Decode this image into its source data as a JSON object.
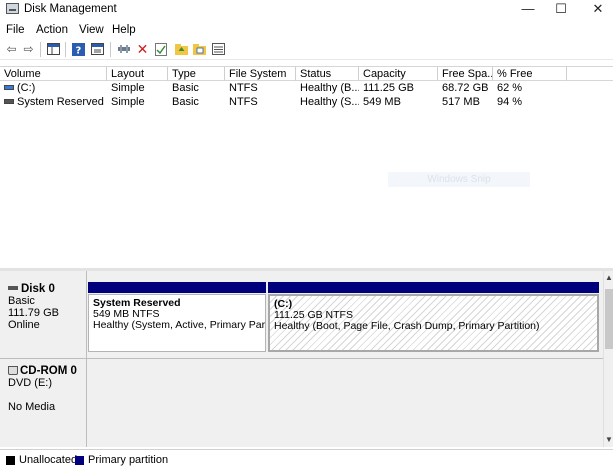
{
  "window": {
    "title": "Disk Management",
    "controls": {
      "minimize": "—",
      "maximize": "☐",
      "close": "✕"
    }
  },
  "menu": [
    "File",
    "Action",
    "View",
    "Help"
  ],
  "toolbar": {
    "buttons": [
      "back-icon",
      "forward-icon",
      "console-tree-icon",
      "help-icon",
      "properties-icon",
      "connect-icon",
      "delete-icon",
      "check-icon",
      "folder-up-icon",
      "folder-open-icon",
      "list-view-icon"
    ]
  },
  "volume_table": {
    "columns": [
      "Volume",
      "Layout",
      "Type",
      "File System",
      "Status",
      "Capacity",
      "Free Spa...",
      "% Free"
    ],
    "rows": [
      [
        "(C:)",
        "Simple",
        "Basic",
        "NTFS",
        "Healthy (B...",
        "111.25 GB",
        "68.72 GB",
        "62 %"
      ],
      [
        "System Reserved",
        "Simple",
        "Basic",
        "NTFS",
        "Healthy (S...",
        "549 MB",
        "517 MB",
        "94 %"
      ]
    ]
  },
  "watermark": "Windows Snip",
  "disks": [
    {
      "name": "Disk 0",
      "lines": [
        "Basic",
        "111.79 GB",
        "Online"
      ],
      "partitions": [
        {
          "name": "System Reserved",
          "size": "549 MB NTFS",
          "status": "Healthy (System, Active, Primary Partit"
        },
        {
          "name": "(C:)",
          "size": "111.25 GB NTFS",
          "status": "Healthy (Boot, Page File, Crash Dump, Primary Partition)"
        }
      ]
    },
    {
      "name": "CD-ROM 0",
      "lines": [
        "DVD (E:)",
        "",
        "No Media"
      ]
    }
  ],
  "legend": [
    {
      "label": "Unallocated",
      "color": "#000000"
    },
    {
      "label": "Primary partition",
      "color": "#00007c"
    }
  ],
  "colors": {
    "partition_bar": "#00007c",
    "selected_hatch": "#d6d6d6"
  }
}
